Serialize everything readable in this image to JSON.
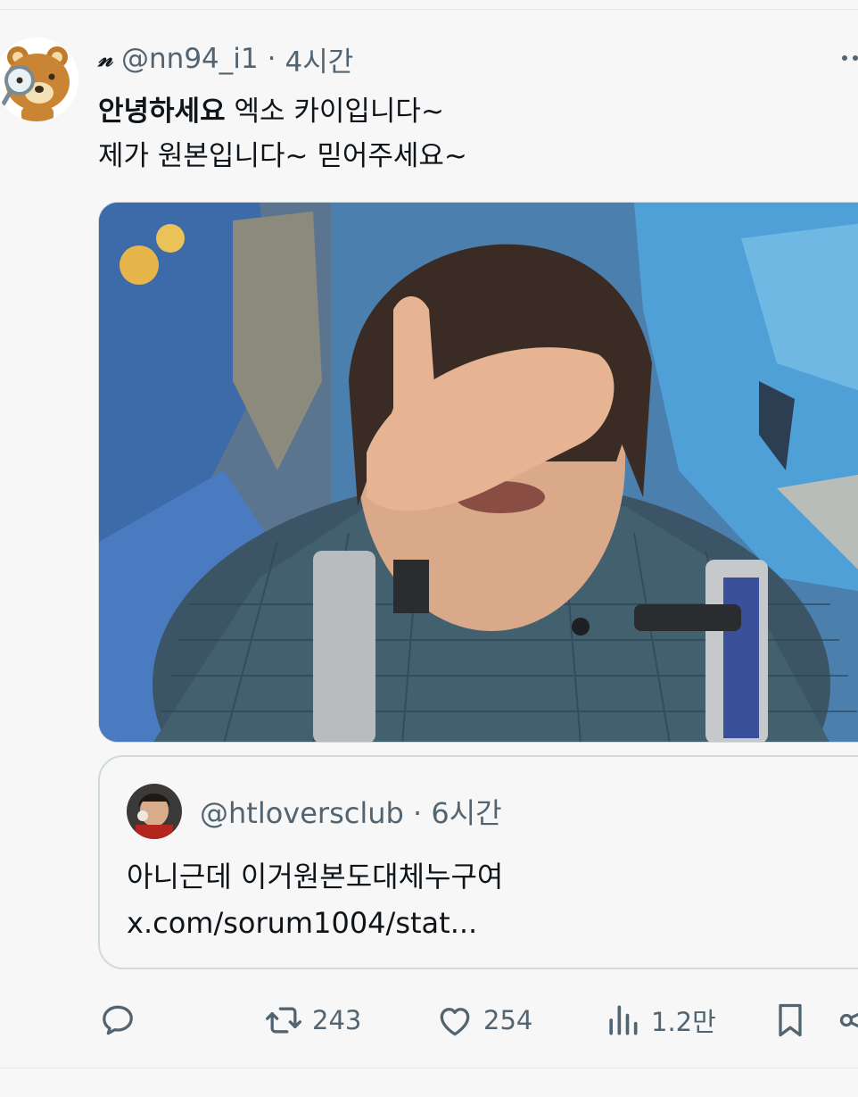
{
  "tweet": {
    "display_name": "𝓃",
    "handle": "@nn94_i1",
    "separator": "·",
    "time": "4시간",
    "text_bold": "안녕하세요",
    "text_line1_rest": " 엑소 카이입니다~",
    "text_line2": "제가 원본입니다~ 믿어주세요~"
  },
  "quote": {
    "handle": "@htloversclub",
    "separator": "·",
    "time": "6시간",
    "text_line1": "아니근데 이거원본도대체누구여",
    "text_line2": "x.com/sorum1004/stat..."
  },
  "actions": {
    "reply_icon": "reply-icon",
    "retweet_count": "243",
    "like_count": "254",
    "views_count": "1.2만",
    "bookmark_icon": "bookmark-icon",
    "share_icon": "share-icon"
  },
  "colors": {
    "text": "#0f1419",
    "secondary": "#536471",
    "border": "#cfd9de",
    "background": "#f7f7f8"
  }
}
